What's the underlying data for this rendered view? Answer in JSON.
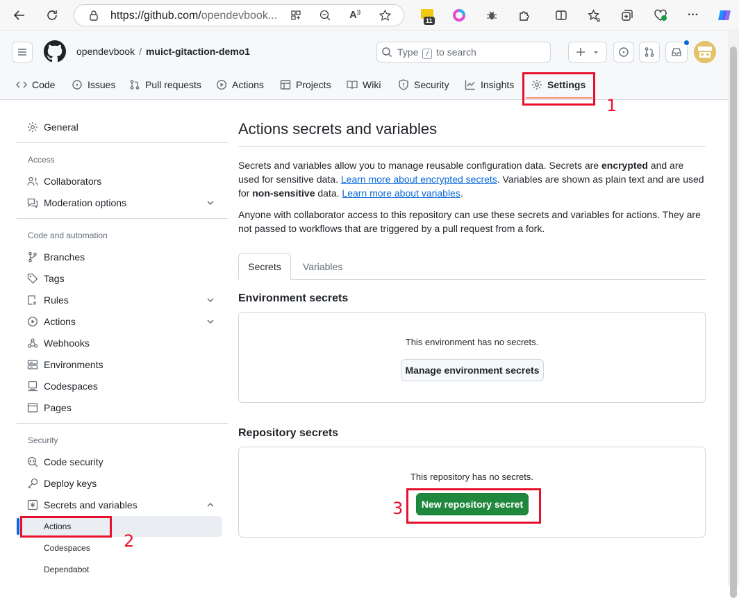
{
  "browser": {
    "url_main": "https://github.com/",
    "url_rest": "opendevbook..."
  },
  "header": {
    "owner": "opendevbook",
    "separator": "/",
    "repo": "muict-gitaction-demo1",
    "search_prefix": "Type",
    "search_key": "/",
    "search_suffix": "to search"
  },
  "repo_tabs": [
    {
      "label": "Code",
      "icon": "code-icon"
    },
    {
      "label": "Issues",
      "icon": "issue-icon"
    },
    {
      "label": "Pull requests",
      "icon": "pull-request-icon"
    },
    {
      "label": "Actions",
      "icon": "play-icon"
    },
    {
      "label": "Projects",
      "icon": "table-icon"
    },
    {
      "label": "Wiki",
      "icon": "book-icon"
    },
    {
      "label": "Security",
      "icon": "shield-icon"
    },
    {
      "label": "Insights",
      "icon": "graph-icon"
    },
    {
      "label": "Settings",
      "icon": "gear-icon"
    }
  ],
  "sidebar": {
    "general": "General",
    "access_heading": "Access",
    "collaborators": "Collaborators",
    "moderation": "Moderation options",
    "code_heading": "Code and automation",
    "branches": "Branches",
    "tags": "Tags",
    "rules": "Rules",
    "actions": "Actions",
    "webhooks": "Webhooks",
    "environments": "Environments",
    "codespaces": "Codespaces",
    "pages": "Pages",
    "security_heading": "Security",
    "code_security": "Code security",
    "deploy_keys": "Deploy keys",
    "secrets": "Secrets and variables",
    "sub_actions": "Actions",
    "sub_codespaces": "Codespaces",
    "sub_dependabot": "Dependabot"
  },
  "main": {
    "title": "Actions secrets and variables",
    "p1_a": "Secrets and variables allow you to manage reusable configuration data. Secrets are ",
    "p1_b": "encrypted",
    "p1_c": " and are used for sensitive data. ",
    "p1_link1": "Learn more about encrypted secrets",
    "p1_d": ". Variables are shown as plain text and are used for ",
    "p1_e": "non-sensitive",
    "p1_f": " data. ",
    "p1_link2": "Learn more about variables",
    "p1_g": ".",
    "p2": "Anyone with collaborator access to this repository can use these secrets and variables for actions. They are not passed to workflows that are triggered by a pull request from a fork.",
    "tab_secrets": "Secrets",
    "tab_variables": "Variables",
    "env_heading": "Environment secrets",
    "env_empty": "This environment has no secrets.",
    "env_button": "Manage environment secrets",
    "repo_heading": "Repository secrets",
    "repo_empty": "This repository has no secrets.",
    "repo_button": "New repository secret"
  },
  "annotations": [
    "1",
    "2",
    "3"
  ],
  "colors": {
    "accent": "#0969da",
    "primary_button": "#1f883d",
    "annotation": "#e8112d",
    "tab_underline": "#fd8c73"
  }
}
